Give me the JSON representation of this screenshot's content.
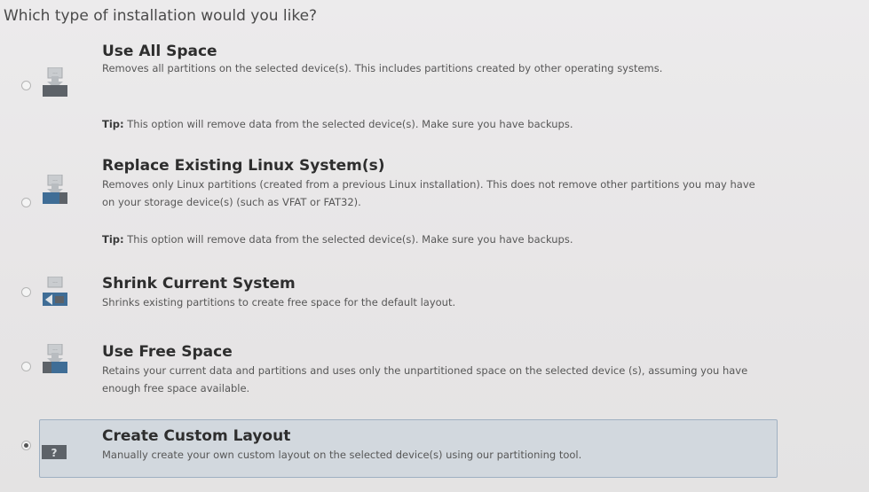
{
  "question": "Which type of installation would you like?",
  "options": [
    {
      "title": "Use All Space",
      "description": "Removes all partitions on the selected device(s).  This includes partitions created by other operating systems.",
      "tip_label": "Tip:",
      "tip_text": " This option will remove data from the selected device(s).  Make sure you have backups.",
      "icon": "disk-erase-icon",
      "selected": false
    },
    {
      "title": "Replace Existing Linux System(s)",
      "description": "Removes only Linux partitions (created from a previous Linux installation).  This does not remove other partitions you may have on your storage device(s) (such as VFAT or FAT32).",
      "tip_label": "Tip:",
      "tip_text": " This option will remove data from the selected device(s).  Make sure you have backups.",
      "icon": "disk-replace-icon",
      "selected": false
    },
    {
      "title": "Shrink Current System",
      "description": "Shrinks existing partitions to create free space for the default layout.",
      "icon": "disk-shrink-icon",
      "selected": false
    },
    {
      "title": "Use Free Space",
      "description": "Retains your current data and partitions and uses only the unpartitioned space on the selected device (s), assuming you have enough free space available.",
      "icon": "disk-free-space-icon",
      "selected": false
    },
    {
      "title": "Create Custom Layout",
      "description": "Manually create your own custom layout on the selected device(s) using our partitioning tool.",
      "icon": "disk-custom-icon",
      "icon_glyph": "?",
      "selected": true
    }
  ]
}
